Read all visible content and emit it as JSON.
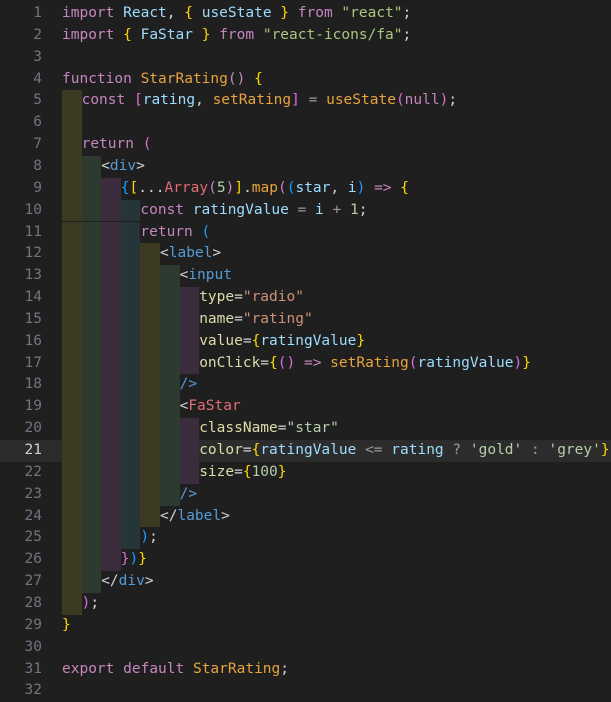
{
  "editor": {
    "language": "javascript-react",
    "total_lines": 32,
    "current_line": 21,
    "background_color": "#1f1f1f",
    "current_line_color": "#2c2c2c",
    "gutter_color": "#6e7681",
    "indent_guide_colors": [
      "#3c3a22",
      "#2c3a30",
      "#3a2c3c",
      "#253538"
    ]
  },
  "lines": [
    {
      "n": "1",
      "indent": 0,
      "tokens": [
        {
          "t": "import",
          "c": "kw"
        },
        {
          "t": " ",
          "c": "punc"
        },
        {
          "t": "React",
          "c": "id"
        },
        {
          "t": ",",
          "c": "punc"
        },
        {
          "t": " ",
          "c": "punc"
        },
        {
          "t": "{",
          "c": "by"
        },
        {
          "t": " ",
          "c": "punc"
        },
        {
          "t": "useState",
          "c": "id"
        },
        {
          "t": " ",
          "c": "punc"
        },
        {
          "t": "}",
          "c": "by"
        },
        {
          "t": " ",
          "c": "punc"
        },
        {
          "t": "from",
          "c": "kw"
        },
        {
          "t": " ",
          "c": "punc"
        },
        {
          "t": "\"react\"",
          "c": "strg"
        },
        {
          "t": ";",
          "c": "punc"
        }
      ]
    },
    {
      "n": "2",
      "indent": 0,
      "tokens": [
        {
          "t": "import",
          "c": "kw"
        },
        {
          "t": " ",
          "c": "punc"
        },
        {
          "t": "{",
          "c": "by"
        },
        {
          "t": " ",
          "c": "punc"
        },
        {
          "t": "FaStar",
          "c": "id"
        },
        {
          "t": " ",
          "c": "punc"
        },
        {
          "t": "}",
          "c": "by"
        },
        {
          "t": " ",
          "c": "punc"
        },
        {
          "t": "from",
          "c": "kw"
        },
        {
          "t": " ",
          "c": "punc"
        },
        {
          "t": "\"react-icons/fa\"",
          "c": "strg"
        },
        {
          "t": ";",
          "c": "punc"
        }
      ]
    },
    {
      "n": "3",
      "indent": 0,
      "tokens": []
    },
    {
      "n": "4",
      "indent": 0,
      "tokens": [
        {
          "t": "function",
          "c": "kw"
        },
        {
          "t": " ",
          "c": "punc"
        },
        {
          "t": "StarRating",
          "c": "func"
        },
        {
          "t": "()",
          "c": "bv"
        },
        {
          "t": " ",
          "c": "punc"
        },
        {
          "t": "{",
          "c": "by"
        }
      ]
    },
    {
      "n": "5",
      "indent": 1,
      "tokens": [
        {
          "t": "const",
          "c": "kw"
        },
        {
          "t": " ",
          "c": "punc"
        },
        {
          "t": "[",
          "c": "bp"
        },
        {
          "t": "rating",
          "c": "id"
        },
        {
          "t": ",",
          "c": "punc"
        },
        {
          "t": " ",
          "c": "punc"
        },
        {
          "t": "setRating",
          "c": "func"
        },
        {
          "t": "]",
          "c": "bp"
        },
        {
          "t": " ",
          "c": "punc"
        },
        {
          "t": "=",
          "c": "op"
        },
        {
          "t": " ",
          "c": "punc"
        },
        {
          "t": "useState",
          "c": "func"
        },
        {
          "t": "(",
          "c": "bp"
        },
        {
          "t": "null",
          "c": "kw"
        },
        {
          "t": ")",
          "c": "bp"
        },
        {
          "t": ";",
          "c": "punc"
        }
      ]
    },
    {
      "n": "6",
      "indent": 1,
      "tokens": []
    },
    {
      "n": "7",
      "indent": 1,
      "tokens": [
        {
          "t": "return",
          "c": "kw"
        },
        {
          "t": " ",
          "c": "punc"
        },
        {
          "t": "(",
          "c": "bp"
        }
      ]
    },
    {
      "n": "8",
      "indent": 2,
      "tokens": [
        {
          "t": "<",
          "c": "punc"
        },
        {
          "t": "div",
          "c": "tag"
        },
        {
          "t": ">",
          "c": "punc"
        }
      ]
    },
    {
      "n": "9",
      "indent": 3,
      "tokens": [
        {
          "t": "{",
          "c": "bb"
        },
        {
          "t": "[",
          "c": "by"
        },
        {
          "t": "...",
          "c": "punc"
        },
        {
          "t": "Array",
          "c": "comp"
        },
        {
          "t": "(",
          "c": "bv"
        },
        {
          "t": "5",
          "c": "num"
        },
        {
          "t": ")",
          "c": "bv"
        },
        {
          "t": "]",
          "c": "by"
        },
        {
          "t": ".",
          "c": "punc"
        },
        {
          "t": "map",
          "c": "func"
        },
        {
          "t": "(",
          "c": "bp"
        },
        {
          "t": "(",
          "c": "bb"
        },
        {
          "t": "star",
          "c": "id"
        },
        {
          "t": ",",
          "c": "punc"
        },
        {
          "t": " ",
          "c": "punc"
        },
        {
          "t": "i",
          "c": "id"
        },
        {
          "t": ")",
          "c": "bb"
        },
        {
          "t": " ",
          "c": "punc"
        },
        {
          "t": "=>",
          "c": "kw"
        },
        {
          "t": " ",
          "c": "punc"
        },
        {
          "t": "{",
          "c": "by"
        }
      ]
    },
    {
      "n": "10",
      "indent": 4,
      "tokens": [
        {
          "t": "const",
          "c": "kw"
        },
        {
          "t": " ",
          "c": "punc"
        },
        {
          "t": "ratingValue",
          "c": "id"
        },
        {
          "t": " ",
          "c": "punc"
        },
        {
          "t": "=",
          "c": "op"
        },
        {
          "t": " ",
          "c": "punc"
        },
        {
          "t": "i",
          "c": "id"
        },
        {
          "t": " ",
          "c": "punc"
        },
        {
          "t": "+",
          "c": "op"
        },
        {
          "t": " ",
          "c": "punc"
        },
        {
          "t": "1",
          "c": "num"
        },
        {
          "t": ";",
          "c": "punc"
        }
      ]
    },
    {
      "n": "11",
      "indent": 4,
      "tokens": [
        {
          "t": "return",
          "c": "kw"
        },
        {
          "t": " ",
          "c": "punc"
        },
        {
          "t": "(",
          "c": "bb"
        }
      ]
    },
    {
      "n": "12",
      "indent": 5,
      "tokens": [
        {
          "t": "<",
          "c": "punc"
        },
        {
          "t": "label",
          "c": "tag"
        },
        {
          "t": ">",
          "c": "punc"
        }
      ]
    },
    {
      "n": "13",
      "indent": 6,
      "tokens": [
        {
          "t": "<",
          "c": "punc"
        },
        {
          "t": "input",
          "c": "tag"
        }
      ]
    },
    {
      "n": "14",
      "indent": 7,
      "tokens": [
        {
          "t": "type",
          "c": "fn"
        },
        {
          "t": "=",
          "c": "punc"
        },
        {
          "t": "\"radio\"",
          "c": "strq"
        }
      ]
    },
    {
      "n": "15",
      "indent": 7,
      "tokens": [
        {
          "t": "name",
          "c": "fn"
        },
        {
          "t": "=",
          "c": "punc"
        },
        {
          "t": "\"rating\"",
          "c": "strq"
        }
      ]
    },
    {
      "n": "16",
      "indent": 7,
      "tokens": [
        {
          "t": "value",
          "c": "fn"
        },
        {
          "t": "=",
          "c": "punc"
        },
        {
          "t": "{",
          "c": "by"
        },
        {
          "t": "ratingValue",
          "c": "id"
        },
        {
          "t": "}",
          "c": "by"
        }
      ]
    },
    {
      "n": "17",
      "indent": 7,
      "tokens": [
        {
          "t": "onClick",
          "c": "fn"
        },
        {
          "t": "=",
          "c": "punc"
        },
        {
          "t": "{",
          "c": "by"
        },
        {
          "t": "()",
          "c": "bp"
        },
        {
          "t": " ",
          "c": "punc"
        },
        {
          "t": "=>",
          "c": "kw"
        },
        {
          "t": " ",
          "c": "punc"
        },
        {
          "t": "setRating",
          "c": "func"
        },
        {
          "t": "(",
          "c": "bp"
        },
        {
          "t": "ratingValue",
          "c": "id"
        },
        {
          "t": ")",
          "c": "bp"
        },
        {
          "t": "}",
          "c": "by"
        }
      ]
    },
    {
      "n": "18",
      "indent": 6,
      "tokens": [
        {
          "t": "/>",
          "c": "tag"
        }
      ]
    },
    {
      "n": "19",
      "indent": 6,
      "tokens": [
        {
          "t": "<",
          "c": "punc"
        },
        {
          "t": "FaStar",
          "c": "comp"
        }
      ]
    },
    {
      "n": "20",
      "indent": 7,
      "tokens": [
        {
          "t": "className",
          "c": "fn"
        },
        {
          "t": "=",
          "c": "punc"
        },
        {
          "t": "\"star\"",
          "c": "str"
        }
      ]
    },
    {
      "n": "21",
      "indent": 7,
      "current": true,
      "tokens": [
        {
          "t": "color",
          "c": "fn"
        },
        {
          "t": "=",
          "c": "punc"
        },
        {
          "t": "{",
          "c": "by"
        },
        {
          "t": "ratingValue",
          "c": "id"
        },
        {
          "t": " ",
          "c": "punc"
        },
        {
          "t": "<=",
          "c": "op"
        },
        {
          "t": " ",
          "c": "punc"
        },
        {
          "t": "rating",
          "c": "id"
        },
        {
          "t": " ",
          "c": "punc"
        },
        {
          "t": "?",
          "c": "op"
        },
        {
          "t": " ",
          "c": "punc"
        },
        {
          "t": "'gold'",
          "c": "str"
        },
        {
          "t": " ",
          "c": "punc"
        },
        {
          "t": ":",
          "c": "op"
        },
        {
          "t": " ",
          "c": "punc"
        },
        {
          "t": "'grey'",
          "c": "str"
        },
        {
          "t": "}",
          "c": "by"
        }
      ]
    },
    {
      "n": "22",
      "indent": 7,
      "tokens": [
        {
          "t": "size",
          "c": "fn"
        },
        {
          "t": "=",
          "c": "punc"
        },
        {
          "t": "{",
          "c": "by"
        },
        {
          "t": "100",
          "c": "num"
        },
        {
          "t": "}",
          "c": "by"
        }
      ]
    },
    {
      "n": "23",
      "indent": 6,
      "tokens": [
        {
          "t": "/>",
          "c": "tag"
        }
      ]
    },
    {
      "n": "24",
      "indent": 5,
      "tokens": [
        {
          "t": "</",
          "c": "punc"
        },
        {
          "t": "label",
          "c": "tag"
        },
        {
          "t": ">",
          "c": "punc"
        }
      ]
    },
    {
      "n": "25",
      "indent": 4,
      "tokens": [
        {
          "t": ")",
          "c": "bb"
        },
        {
          "t": ";",
          "c": "punc"
        }
      ]
    },
    {
      "n": "26",
      "indent": 3,
      "tokens": [
        {
          "t": "}",
          "c": "bp"
        },
        {
          "t": ")",
          "c": "bb"
        },
        {
          "t": "}",
          "c": "by"
        }
      ]
    },
    {
      "n": "27",
      "indent": 2,
      "tokens": [
        {
          "t": "</",
          "c": "punc"
        },
        {
          "t": "div",
          "c": "tag"
        },
        {
          "t": ">",
          "c": "punc"
        }
      ]
    },
    {
      "n": "28",
      "indent": 1,
      "tokens": [
        {
          "t": ")",
          "c": "bp"
        },
        {
          "t": ";",
          "c": "punc"
        }
      ]
    },
    {
      "n": "29",
      "indent": 0,
      "tokens": [
        {
          "t": "}",
          "c": "by"
        }
      ]
    },
    {
      "n": "30",
      "indent": 0,
      "tokens": []
    },
    {
      "n": "31",
      "indent": 0,
      "tokens": [
        {
          "t": "export",
          "c": "kw"
        },
        {
          "t": " ",
          "c": "punc"
        },
        {
          "t": "default",
          "c": "kw"
        },
        {
          "t": " ",
          "c": "punc"
        },
        {
          "t": "StarRating",
          "c": "func"
        },
        {
          "t": ";",
          "c": "punc"
        }
      ]
    },
    {
      "n": "32",
      "indent": 0,
      "tokens": []
    }
  ]
}
